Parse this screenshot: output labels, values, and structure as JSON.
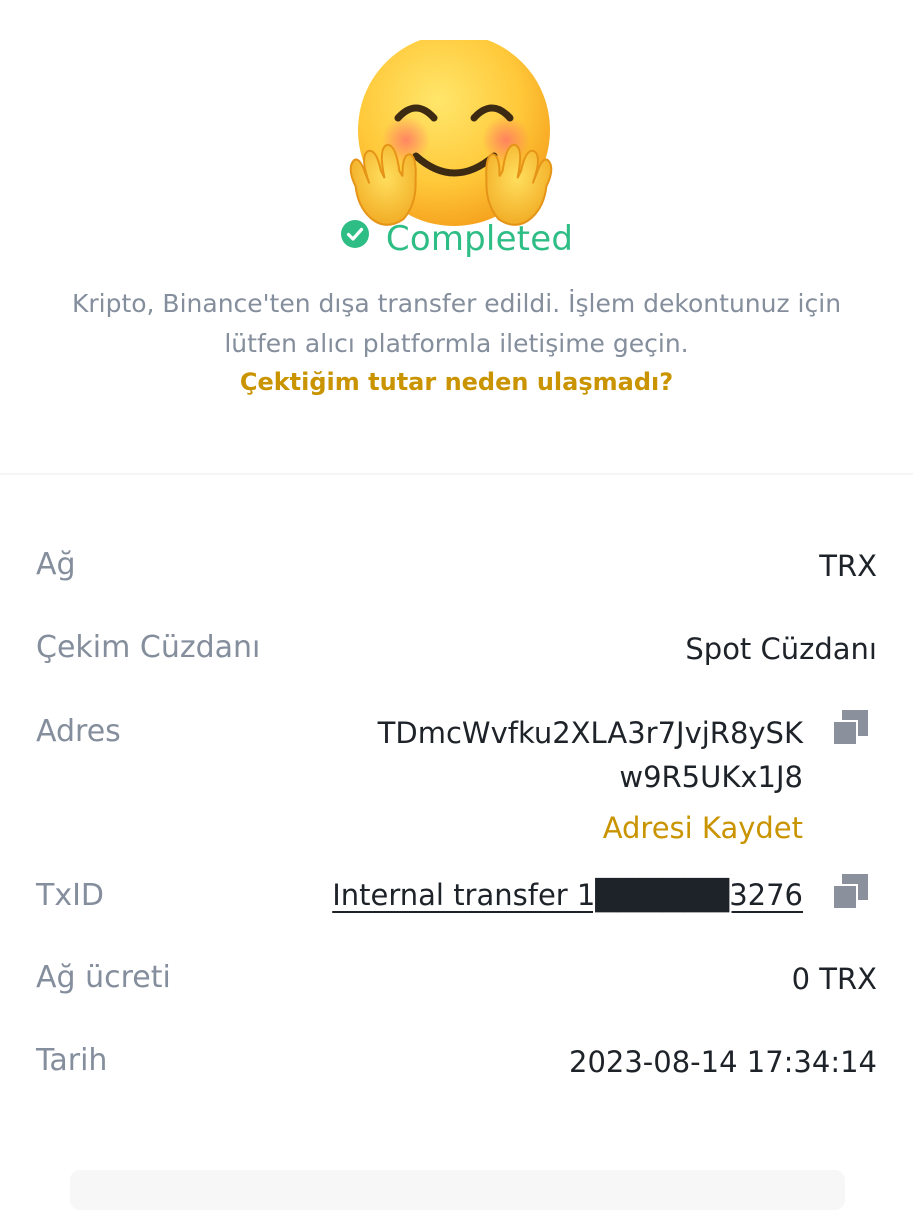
{
  "status": {
    "text": "Completed",
    "color": "#2ebd85"
  },
  "description": "Kripto, Binance'ten dışa transfer edildi. İşlem dekontunuz için lütfen alıcı platformla iletişime geçin.",
  "help_link": "Çektiğim tutar neden ulaşmadı?",
  "icons": {
    "hero": "hugging-face-emoji",
    "status": "check-circle-icon",
    "copy": "copy-icon"
  },
  "details": {
    "network": {
      "label": "Ağ",
      "value": "TRX"
    },
    "wallet": {
      "label": "Çekim Cüzdanı",
      "value": "Spot Cüzdanı"
    },
    "address": {
      "label": "Adres",
      "line1": "TDmcWvfku2XLA3r7JvjR8ySK",
      "line2": "w9R5UKx1J8",
      "save_label": "Adresi Kaydet"
    },
    "txid": {
      "label": "TxID",
      "value": "Internal transfer 1██████3276"
    },
    "fee": {
      "label": "Ağ ücreti",
      "value": "0 TRX"
    },
    "date": {
      "label": "Tarih",
      "value": "2023-08-14 17:34:14"
    }
  },
  "colors": {
    "accent": "#c99400",
    "label": "#848e9c",
    "text": "#1e2329"
  }
}
